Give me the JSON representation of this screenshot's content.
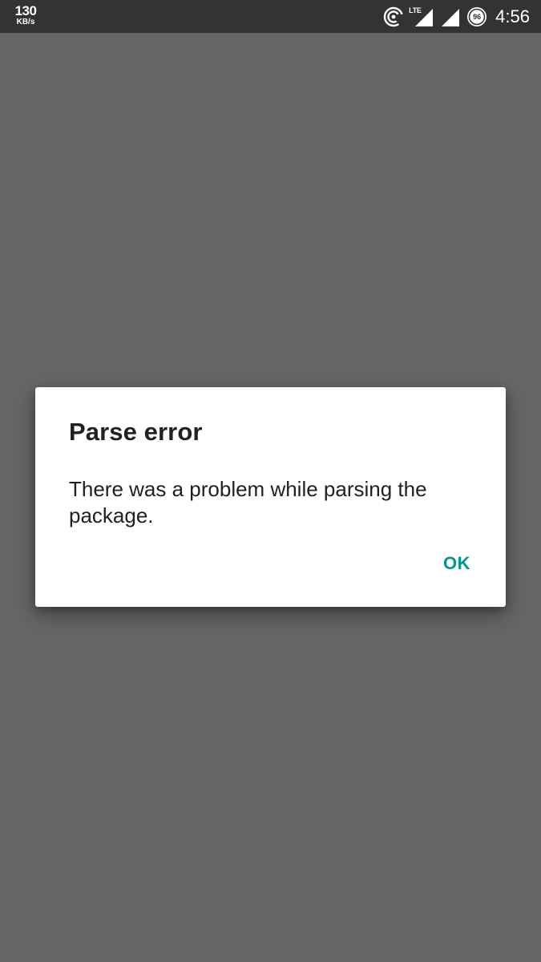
{
  "status_bar": {
    "network_speed_value": "130",
    "network_speed_unit": "KB/s",
    "network_type": "LTE",
    "battery_level": "96",
    "time": "4:56",
    "icons": [
      "hotspot-icon",
      "lte-signal-icon",
      "signal-icon",
      "battery-icon"
    ]
  },
  "dialog": {
    "title": "Parse error",
    "message": "There was a problem while parsing the package.",
    "ok_label": "OK"
  },
  "colors": {
    "background_dim": "#666666",
    "status_bar": "#333333",
    "dialog_background": "#ffffff",
    "text_primary": "#212121",
    "accent": "#009688"
  }
}
